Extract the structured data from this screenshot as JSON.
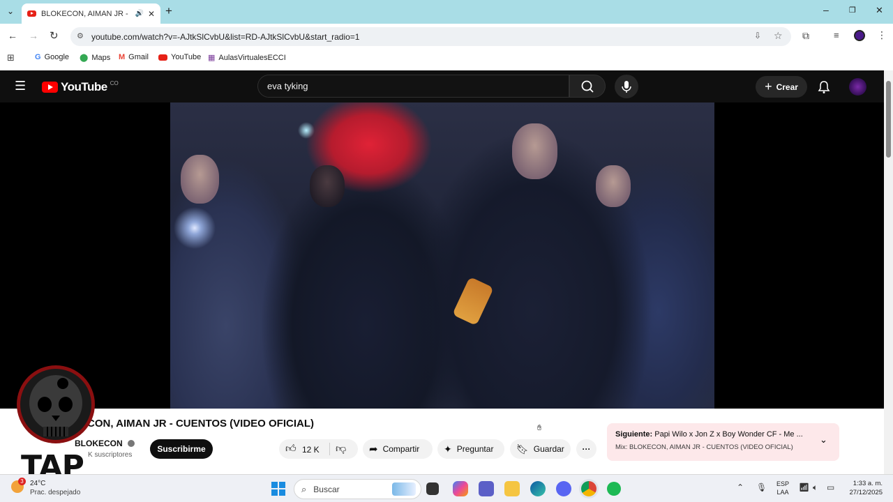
{
  "browser": {
    "tab_title": "BLOKECON, AIMAN JR - CU",
    "url": "youtube.com/watch?v=-AJtkSlCvbU&list=RD-AJtkSlCvbU&start_radio=1",
    "bookmarks": [
      "Google",
      "Maps",
      "Gmail",
      "YouTube",
      "AulasVirtualesECCI"
    ]
  },
  "youtube": {
    "logo_text": "YouTube",
    "region": "CO",
    "search_value": "eva tyking",
    "create_label": "Crear"
  },
  "video": {
    "title": "CON, AIMAN JR - CUENTOS (VIDEO OFICIAL)",
    "channel": "BLOKECON",
    "subscribers": "K suscriptores",
    "subscribe_label": "Suscribirme",
    "likes": "12 K",
    "share_label": "Compartir",
    "ask_label": "Preguntar",
    "save_label": "Guardar"
  },
  "up_next": {
    "prefix": "Siguiente:",
    "title": "Papi Wilo x Jon Z x Boy Wonder CF - Me ...",
    "mix": "Mix: BLOKECON, AIMAN JR - CUENTOS (VIDEO OFICIAL)"
  },
  "watermark": {
    "text": "TAP"
  },
  "taskbar": {
    "weather_temp": "24°C",
    "weather_desc": "Prac. despejado",
    "weather_badge": "3",
    "search_placeholder": "Buscar",
    "lang_top": "ESP",
    "lang_bottom": "LAA",
    "time": "1:33 a. m.",
    "date": "27/12/2025"
  },
  "colors": {
    "tabstrip": "#a9dde6",
    "youtube_red": "#ff0000",
    "yt_header": "#0f0f0f",
    "up_next_bg": "#fde8ea"
  }
}
